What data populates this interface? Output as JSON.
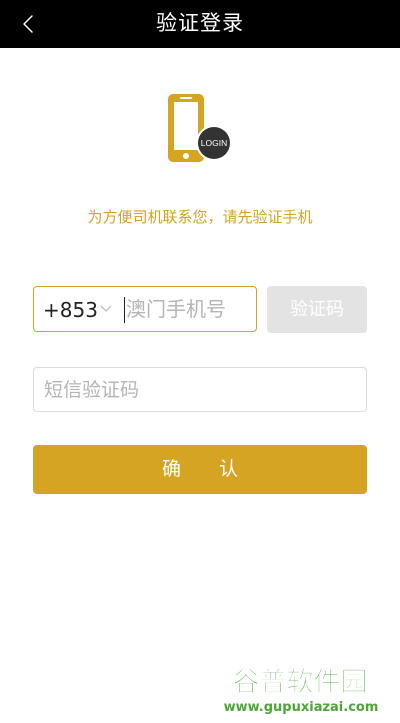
{
  "nav": {
    "back_icon": "chevron-left-icon",
    "title": "验证登录"
  },
  "hero": {
    "icon": "phone-login-icon",
    "badge_text": "LOGIN"
  },
  "hint": "为方便司机联系您，请先验证手机",
  "phone": {
    "country_code": "+853",
    "dropdown_icon": "chevron-down-icon",
    "value": "",
    "placeholder": "澳门手机号"
  },
  "send_code": {
    "label": "验证码"
  },
  "sms": {
    "value": "",
    "placeholder": "短信验证码"
  },
  "confirm": {
    "label": "确 认"
  },
  "watermark": {
    "title": "谷普软件园",
    "url": "www.gupuxiazai.com"
  },
  "colors": {
    "brand": "#d4a422",
    "nav_bg": "#000000",
    "disabled_button": "#e3e3e3",
    "placeholder": "#b5b5b5",
    "watermark_green": "#4fa53a"
  }
}
